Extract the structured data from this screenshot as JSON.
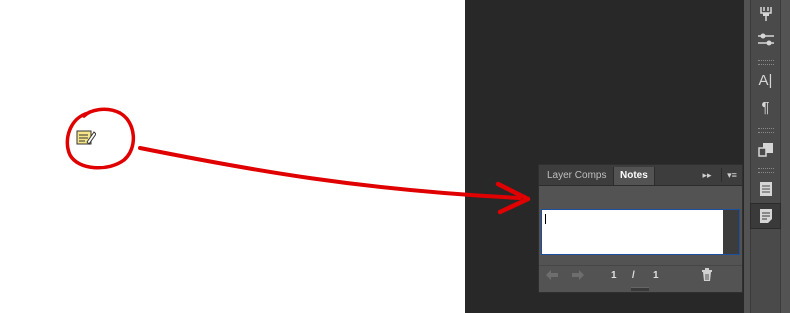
{
  "panel": {
    "tabs": [
      {
        "label": "Layer Comps",
        "active": false
      },
      {
        "label": "Notes",
        "active": true
      }
    ],
    "expand_icon": "double-chevron-right-icon",
    "menu_icon": "panel-menu-icon",
    "note_text": "",
    "footer": {
      "current_page": "1",
      "separator": "/",
      "total_pages": "1",
      "prev_icon": "arrow-left-icon",
      "next_icon": "arrow-right-icon",
      "delete_icon": "trash-icon"
    }
  },
  "toolbar": {
    "tools": [
      "brush-presets-icon",
      "adjustments-icon",
      "character-icon",
      "paragraph-icon",
      "clone-source-icon",
      "layer-comps-icon",
      "notes-icon"
    ],
    "character_glyph": "A|",
    "paragraph_glyph": "¶"
  },
  "annotation": {
    "icon": "note-tool-icon",
    "circle_color": "#e00000",
    "arrow_color": "#e00000"
  },
  "colors": {
    "workspace": "#282828",
    "panel": "#535353",
    "accent_border": "#1e4f9e"
  }
}
